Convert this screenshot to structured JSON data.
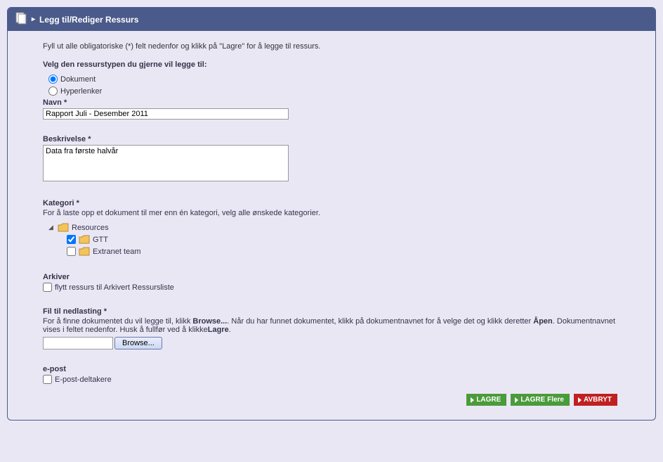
{
  "header": {
    "title": "Legg til/Rediger Ressurs"
  },
  "intro": "Fyll ut alle obligatoriske (*) felt nedenfor og klikk på \"Lagre\" for å legge til ressurs.",
  "typeSection": {
    "label": "Velg den ressurstypen du gjerne vil legge til:",
    "options": {
      "dokument": "Dokument",
      "hyperlenker": "Hyperlenker"
    }
  },
  "nameField": {
    "label": "Navn *",
    "value": "Rapport Juli - Desember 2011"
  },
  "descField": {
    "label": "Beskrivelse *",
    "value": "Data fra første halvår"
  },
  "categoryField": {
    "label": "Kategori *",
    "help": "For å laste opp et dokument til mer enn én kategori, velg alle ønskede kategorier.",
    "root": "Resources",
    "children": {
      "gtt": "GTT",
      "extranet": "Extranet team"
    }
  },
  "archiveField": {
    "label": "Arkiver",
    "checkbox": "flytt ressurs til Arkivert Ressursliste"
  },
  "fileField": {
    "label": "Fil til nedlasting *",
    "help1": "For å finne dokumentet du vil legge til, klikk ",
    "help1b": "Browse...",
    "help2": ". Når du har funnet dokumentet, klikk på dokumentnavnet for å velge det og klikk deretter ",
    "help2b": "Åpen",
    "help3": ". Dokumentnavnet vises i feltet nedenfor. Husk å fullfør ved å klikke",
    "help3b": "Lagre",
    "help4": ".",
    "browseLabel": "Browse..."
  },
  "emailField": {
    "label": "e-post",
    "checkbox": "E-post-deltakere"
  },
  "buttons": {
    "save": "LAGRE",
    "saveMore": "LAGRE Flere",
    "cancel": "AVBRYT"
  }
}
